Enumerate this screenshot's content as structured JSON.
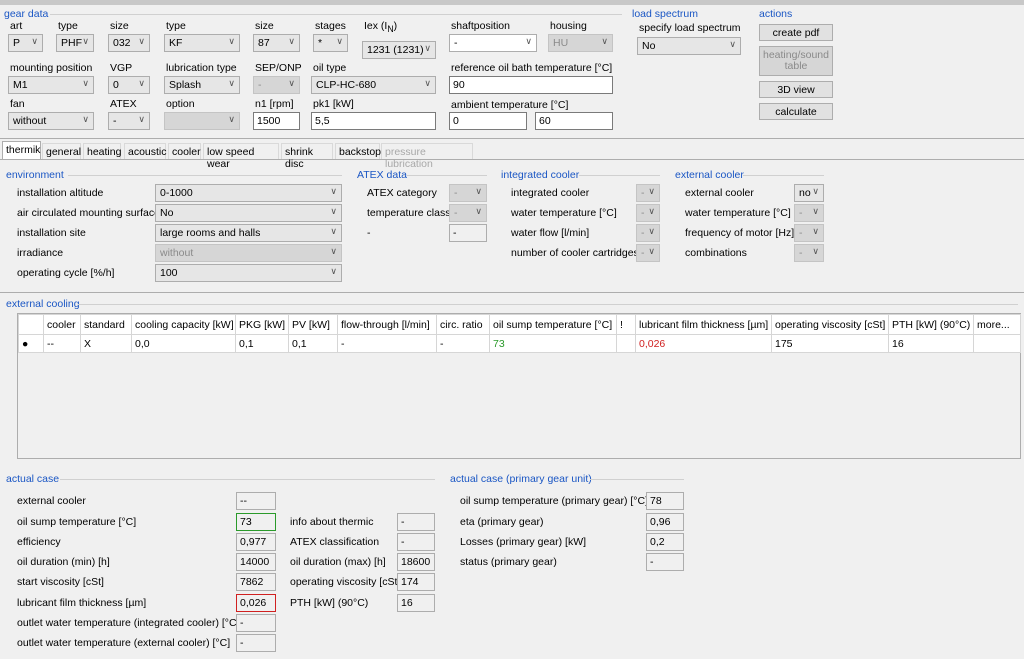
{
  "gear_data": {
    "title": "gear data",
    "art": {
      "label": "art",
      "value": "P"
    },
    "type1": {
      "label": "type",
      "value": "PHF"
    },
    "size1": {
      "label": "size",
      "value": "032"
    },
    "type2": {
      "label": "type",
      "value": "KF"
    },
    "size2": {
      "label": "size",
      "value": "87"
    },
    "stages": {
      "label": "stages",
      "value": "*"
    },
    "iex": {
      "label": "Iex (I",
      "label_sub": "N",
      "label_end": ")",
      "value": "1231 (1231)"
    },
    "shaftposition": {
      "label": "shaftposition",
      "value": "-"
    },
    "housing": {
      "label": "housing",
      "value": "HU"
    },
    "mounting_position": {
      "label": "mounting position",
      "value": "M1"
    },
    "vgp": {
      "label": "VGP",
      "value": "0"
    },
    "lubrication_type": {
      "label": "lubrication type",
      "value": "Splash"
    },
    "sep_onp": {
      "label": "SEP/ONP",
      "value": "-"
    },
    "oil_type": {
      "label": "oil type",
      "value": "CLP-HC-680"
    },
    "ref_oil_temp": {
      "label": "reference oil bath temperature [°C]",
      "value": "90"
    },
    "fan": {
      "label": "fan",
      "value": "without"
    },
    "atex": {
      "label": "ATEX",
      "value": "-"
    },
    "option": {
      "label": "option",
      "value": ""
    },
    "n1": {
      "label": "n1 [rpm]",
      "value": "1500"
    },
    "pk1": {
      "label": "pk1 [kW]",
      "value": "5,5"
    },
    "ambient": {
      "label": "ambient temperature [°C]",
      "min": "0",
      "max": "60"
    }
  },
  "load_spectrum": {
    "title": "load spectrum",
    "label": "specify load spectrum",
    "value": "No"
  },
  "actions": {
    "title": "actions",
    "create_pdf": "create pdf",
    "heating_sound": "heating/sound table",
    "view3d": "3D view",
    "calculate": "calculate"
  },
  "tabs": [
    "thermik",
    "general",
    "heating",
    "acoustic",
    "cooler",
    "low speed wear",
    "shrink disc",
    "backstop",
    "pressure lubrication"
  ],
  "environment": {
    "title": "environment",
    "rows": [
      {
        "label": "installation altitude",
        "value": "0-1000"
      },
      {
        "label": "air circulated mounting surface",
        "value": "No"
      },
      {
        "label": "installation site",
        "value": "large rooms and halls"
      },
      {
        "label": "irradiance",
        "value": "without"
      },
      {
        "label": "operating cycle [%/h]",
        "value": "100"
      }
    ]
  },
  "atex_data": {
    "title": "ATEX data",
    "rows": [
      {
        "label": "ATEX category",
        "value": "-"
      },
      {
        "label": "temperature class",
        "value": "-"
      },
      {
        "label": "-",
        "value": "-"
      }
    ]
  },
  "integrated_cooler": {
    "title": "integrated cooler",
    "rows": [
      {
        "label": "integrated cooler",
        "value": "-"
      },
      {
        "label": "water temperature [°C]",
        "value": "-"
      },
      {
        "label": "water flow [l/min]",
        "value": "-"
      },
      {
        "label": "number of cooler cartridges",
        "value": "-"
      }
    ]
  },
  "external_cooler": {
    "title": "external cooler",
    "rows": [
      {
        "label": "external cooler",
        "value": "no"
      },
      {
        "label": "water temperature [°C]",
        "value": "-"
      },
      {
        "label": "frequency of motor [Hz]",
        "value": "-"
      },
      {
        "label": "combinations",
        "value": "-"
      }
    ]
  },
  "external_cooling": {
    "title": "external cooling",
    "columns": [
      "",
      "cooler",
      "standard",
      "cooling capacity [kW]",
      "PKG [kW]",
      "PV [kW]",
      "flow-through [l/min]",
      "circ. ratio",
      "oil sump temperature [°C]",
      "!",
      "lubricant film thickness [µm]",
      "operating viscosity [cSt]",
      "PTH [kW] (90°C)",
      "more..."
    ],
    "rows": [
      [
        "●",
        "--",
        "X",
        "0,0",
        "0,1",
        "0,1",
        "-",
        "-",
        "73",
        "",
        "0,026",
        "175",
        "16",
        ""
      ]
    ]
  },
  "actual_case": {
    "title": "actual case",
    "left": [
      {
        "label": "external cooler",
        "value": "--"
      },
      {
        "label": "oil sump temperature [°C]",
        "value": "73"
      },
      {
        "label": "efficiency",
        "value": "0,977"
      },
      {
        "label": "oil duration (min) [h]",
        "value": "14000"
      },
      {
        "label": "start viscosity [cSt]",
        "value": "7862"
      },
      {
        "label": "lubricant film thickness [µm]",
        "value": "0,026"
      },
      {
        "label": "outlet water temperature (integrated cooler) [°C]",
        "value": "-"
      },
      {
        "label": "outlet water temperature (external cooler) [°C]",
        "value": "-"
      }
    ],
    "mid": [
      {
        "label": "info about thermic",
        "value": "-"
      },
      {
        "label": "ATEX classification",
        "value": "-"
      },
      {
        "label": "oil duration (max) [h]",
        "value": "18600"
      },
      {
        "label": "operating viscosity [cSt]",
        "value": "174"
      },
      {
        "label": "PTH [kW] (90°C)",
        "value": "16"
      }
    ]
  },
  "primary": {
    "title": "actual case (primary gear unit)",
    "rows": [
      {
        "label": "oil sump temperature (primary gear) [°C]",
        "value": "78"
      },
      {
        "label": "eta (primary gear)",
        "value": "0,96"
      },
      {
        "label": "Losses (primary gear) [kW]",
        "value": "0,2"
      },
      {
        "label": "status (primary gear)",
        "value": "-"
      }
    ]
  },
  "colors": {
    "section_title": "#1a56c4",
    "ok": "#2a9a2a",
    "warn": "#d02020"
  }
}
